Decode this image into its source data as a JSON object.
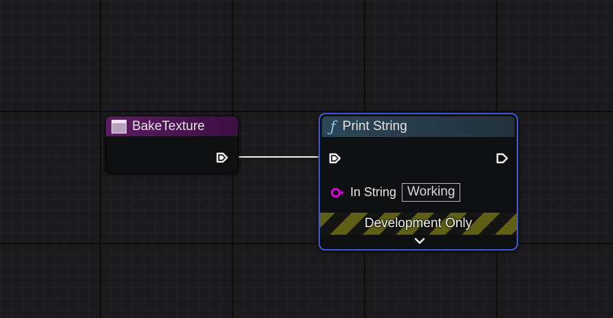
{
  "graph": {
    "event_node": {
      "title": "BakeTexture",
      "header_color": "#5c1a63",
      "icon": "event-icon"
    },
    "print_string_node": {
      "function_icon": "ƒ",
      "title": "Print String",
      "header_color": "#2c4656",
      "border_color": "#3f58d8",
      "inputs": [
        {
          "label": "In String",
          "value": "Working",
          "pin_color": "#e400e0"
        }
      ],
      "development_only_label": "Development Only",
      "expand_icon": "chevron-down-icon"
    },
    "wire_color": "#ffffff"
  }
}
